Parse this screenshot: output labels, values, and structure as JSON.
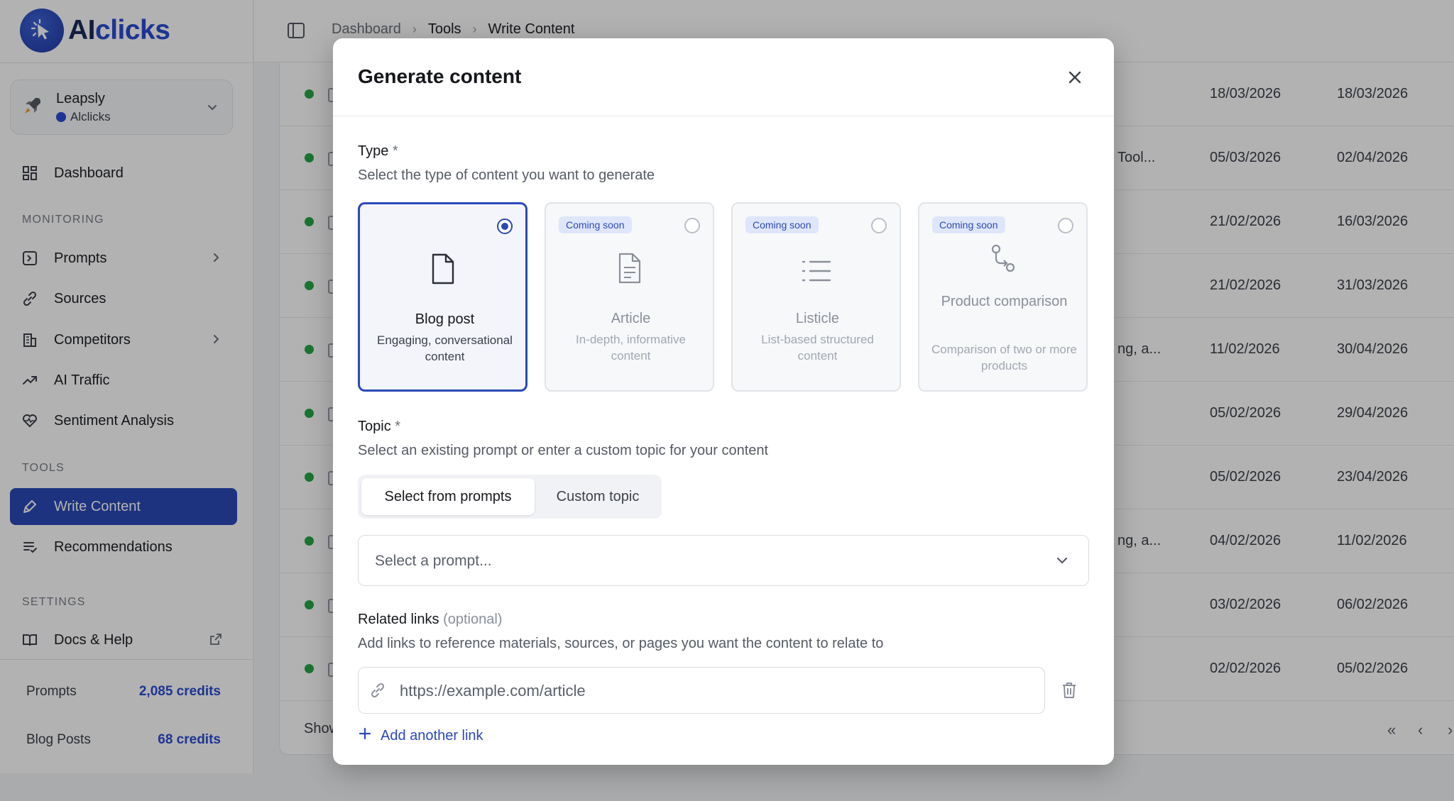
{
  "brand": {
    "ai": "AI",
    "clicks": "clicks",
    "accent": "#2a4bd1"
  },
  "workspace": {
    "name": "Leapsly",
    "org": "Alclicks"
  },
  "sidebar": {
    "dashboard": "Dashboard",
    "monitoring_label": "MONITORING",
    "prompts": "Prompts",
    "sources": "Sources",
    "competitors": "Competitors",
    "ai_traffic": "AI Traffic",
    "sentiment": "Sentiment Analysis",
    "tools_label": "TOOLS",
    "write_content": "Write Content",
    "recommendations": "Recommendations",
    "settings_label": "SETTINGS",
    "docs": "Docs & Help"
  },
  "credits": [
    {
      "label": "Prompts",
      "value": "2,085 credits"
    },
    {
      "label": "Blog Posts",
      "value": "68 credits"
    }
  ],
  "breadcrumb": {
    "home": "Dashboard",
    "section": "Tools",
    "current": "Write Content"
  },
  "table": {
    "rows": [
      {
        "snippet": "",
        "d1": "18/03/2026",
        "d2": "18/03/2026"
      },
      {
        "snippet": "Tool...",
        "d1": "05/03/2026",
        "d2": "02/04/2026"
      },
      {
        "snippet": "",
        "d1": "21/02/2026",
        "d2": "16/03/2026"
      },
      {
        "snippet": "",
        "d1": "21/02/2026",
        "d2": "31/03/2026"
      },
      {
        "snippet": "ng, a...",
        "d1": "11/02/2026",
        "d2": "30/04/2026"
      },
      {
        "snippet": "",
        "d1": "05/02/2026",
        "d2": "29/04/2026"
      },
      {
        "snippet": "",
        "d1": "05/02/2026",
        "d2": "23/04/2026"
      },
      {
        "snippet": "ng, a...",
        "d1": "04/02/2026",
        "d2": "11/02/2026"
      },
      {
        "snippet": "",
        "d1": "03/02/2026",
        "d2": "06/02/2026"
      },
      {
        "snippet": "",
        "d1": "02/02/2026",
        "d2": "05/02/2026"
      }
    ],
    "footer_show": "Show"
  },
  "modal": {
    "title": "Generate content",
    "type_label": "Type",
    "required_mark": "*",
    "type_help": "Select the type of content you want to generate",
    "types": [
      {
        "name": "Blog post",
        "desc": "Engaging, conversational content",
        "badge": "",
        "selected": true
      },
      {
        "name": "Article",
        "desc": "In-depth, informative content",
        "badge": "Coming soon",
        "selected": false
      },
      {
        "name": "Listicle",
        "desc": "List-based structured content",
        "badge": "Coming soon",
        "selected": false
      },
      {
        "name": "Product comparison",
        "desc": "Comparison of two or more products",
        "badge": "Coming soon",
        "selected": false
      }
    ],
    "topic_label": "Topic",
    "topic_help": "Select an existing prompt or enter a custom topic for your content",
    "seg_prompts": "Select from prompts",
    "seg_custom": "Custom topic",
    "select_placeholder": "Select a prompt...",
    "links_label": "Related links",
    "links_optional": "(optional)",
    "links_help": "Add links to reference materials, sources, or pages you want the content to relate to",
    "link_placeholder": "https://example.com/article",
    "add_link": "Add another link"
  }
}
